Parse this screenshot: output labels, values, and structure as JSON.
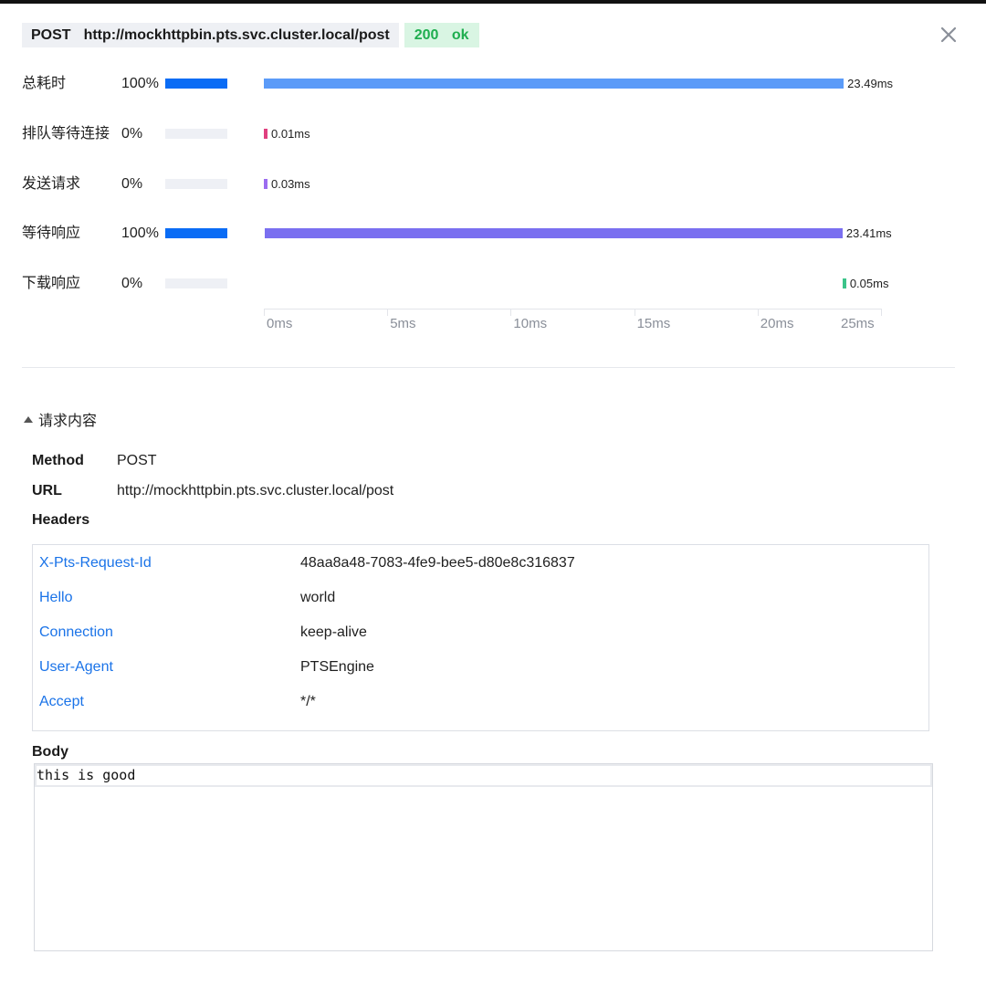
{
  "request": {
    "method": "POST",
    "url": "http://mockhttpbin.pts.svc.cluster.local/post",
    "status": "200 ok"
  },
  "timeline": {
    "rows": [
      {
        "label": "总耗时",
        "percent": "100%",
        "percent_value": 100,
        "start_ms": 0,
        "duration_ms": 23.49,
        "value_label": "23.49ms",
        "color": "#5b9bf8"
      },
      {
        "label": "排队等待连接",
        "percent": "0%",
        "percent_value": 0,
        "start_ms": 0,
        "duration_ms": 0.01,
        "value_label": "0.01ms",
        "color": "#e0407f"
      },
      {
        "label": "发送请求",
        "percent": "0%",
        "percent_value": 0,
        "start_ms": 0,
        "duration_ms": 0.03,
        "value_label": "0.03ms",
        "color": "#9b6cf0"
      },
      {
        "label": "等待响应",
        "percent": "100%",
        "percent_value": 100,
        "start_ms": 0.03,
        "duration_ms": 23.41,
        "value_label": "23.41ms",
        "color": "#7a6ff0"
      },
      {
        "label": "下载响应",
        "percent": "0%",
        "percent_value": 0,
        "start_ms": 23.44,
        "duration_ms": 0.05,
        "value_label": "0.05ms",
        "color": "#3cc48a"
      }
    ],
    "axis": {
      "max_ms": 25,
      "ticks": [
        "0ms",
        "5ms",
        "10ms",
        "15ms",
        "20ms",
        "25ms"
      ]
    }
  },
  "details": {
    "section_title": "请求内容",
    "method_key": "Method",
    "method_value": "POST",
    "url_key": "URL",
    "url_value": "http://mockhttpbin.pts.svc.cluster.local/post",
    "headers_label": "Headers",
    "headers": [
      {
        "key": "X-Pts-Request-Id",
        "value": "48aa8a48-7083-4fe9-bee5-d80e8c316837"
      },
      {
        "key": "Hello",
        "value": "world"
      },
      {
        "key": "Connection",
        "value": "keep-alive"
      },
      {
        "key": "User-Agent",
        "value": "PTSEngine"
      },
      {
        "key": "Accept",
        "value": "*/*"
      }
    ],
    "body_label": "Body",
    "body_text": "this is good"
  },
  "icons": {
    "close": "close-icon",
    "collapse": "triangle-up-icon"
  }
}
